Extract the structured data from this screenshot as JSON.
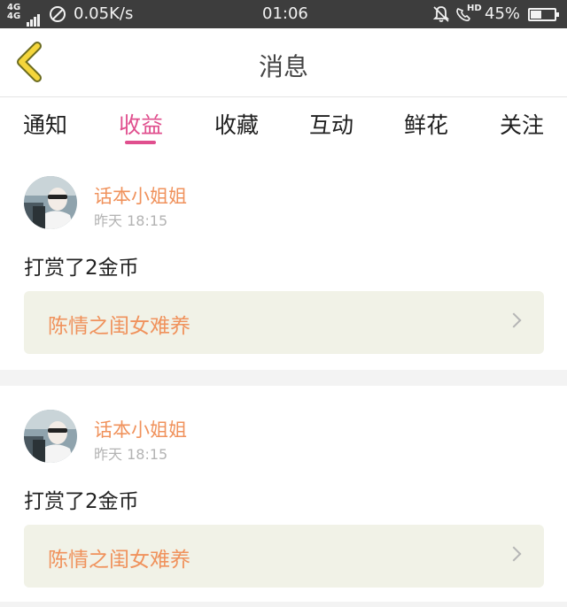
{
  "status_bar": {
    "network": "4G",
    "speed": "0.05K/s",
    "time": "01:06",
    "hd": "HD",
    "battery": "45%",
    "battery_level": 0.45,
    "text_color": "#f2f2f2",
    "background": "#3d3d3d"
  },
  "nav": {
    "title": "消息",
    "back_icon": "chevron-left-icon",
    "back_color": "#f5d63b"
  },
  "tabs": {
    "items": [
      {
        "label": "通知"
      },
      {
        "label": "收益"
      },
      {
        "label": "收藏"
      },
      {
        "label": "互动"
      },
      {
        "label": "鲜花"
      },
      {
        "label": "关注"
      }
    ],
    "active": "收益",
    "active_color": "#e04f8e"
  },
  "messages": [
    {
      "username": "话本小姐姐",
      "timestamp": "昨天 18:15",
      "text": "打赏了2金币",
      "book_title": "陈情之闺女难养"
    },
    {
      "username": "话本小姐姐",
      "timestamp": "昨天 18:15",
      "text": "打赏了2金币",
      "book_title": "陈情之闺女难养"
    }
  ],
  "colors": {
    "accent_orange": "#f0925c",
    "book_card_bg": "#f1f2e7",
    "timestamp_grey": "#b3b3b3"
  }
}
